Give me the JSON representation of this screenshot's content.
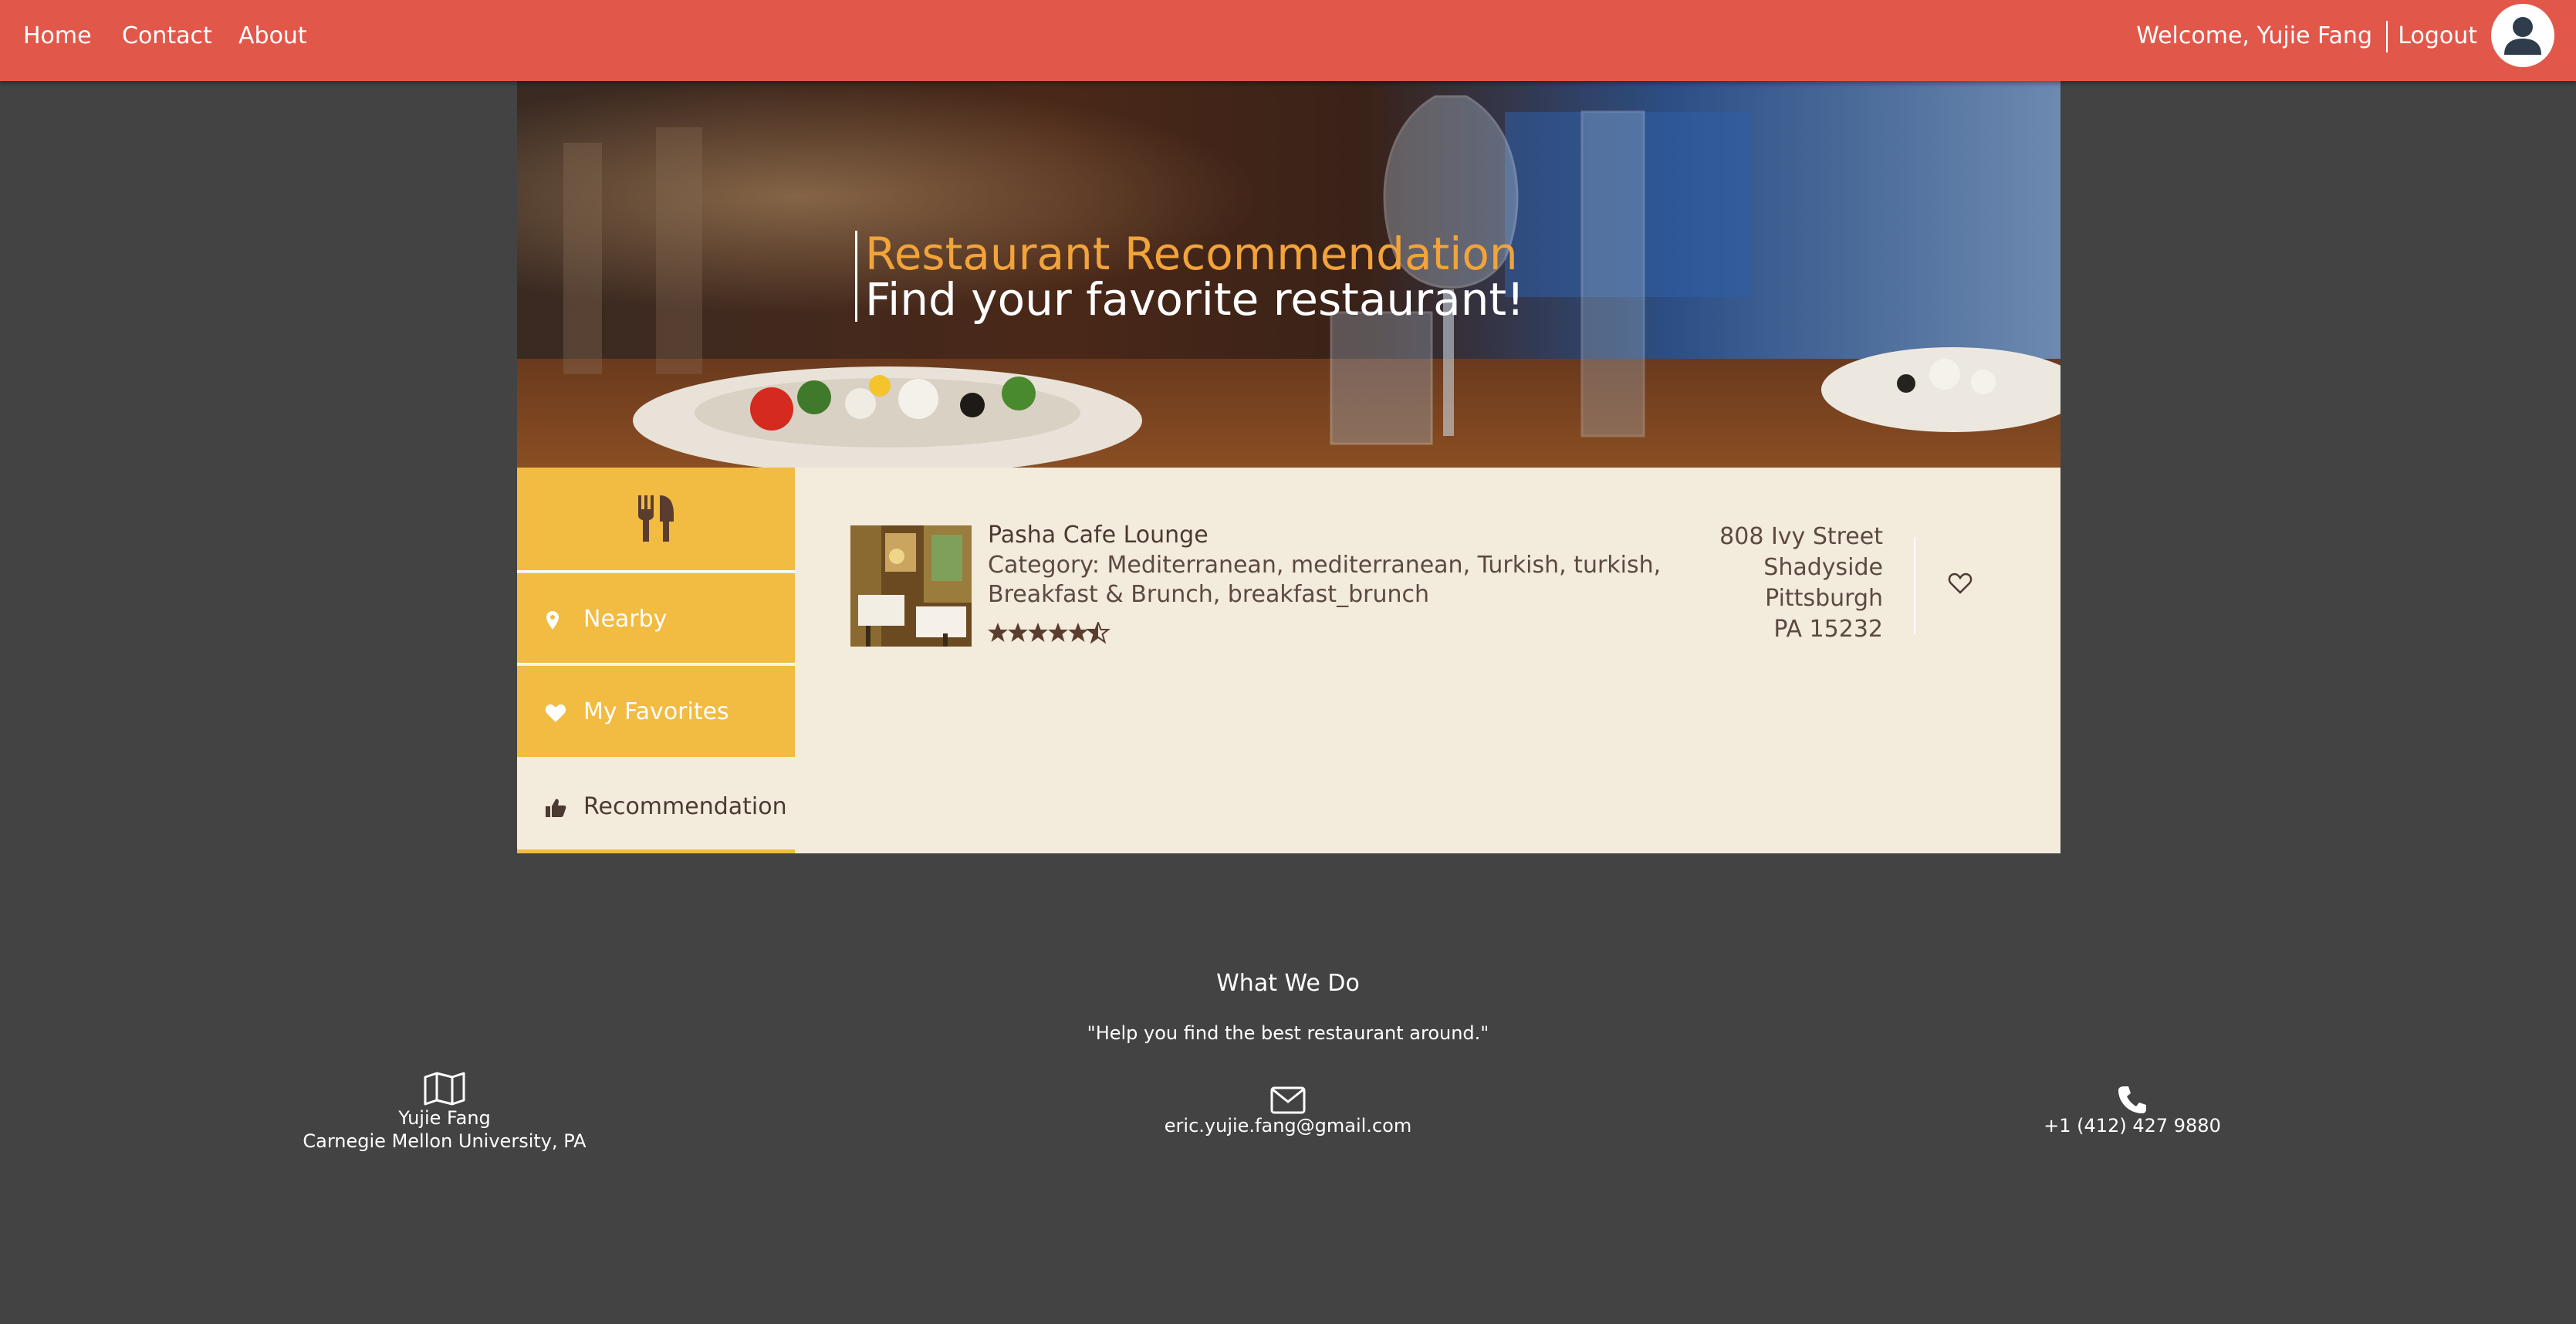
{
  "nav": {
    "home": "Home",
    "contact": "Contact",
    "about": "About",
    "welcome": "Welcome, Yujie Fang",
    "logout": "Logout",
    "avatar_icon": "user-avatar-icon"
  },
  "hero": {
    "title": "Restaurant Recommendation",
    "subtitle": "Find your favorite restaurant!"
  },
  "sidebar": {
    "header_icon": "cutlery-icon",
    "items": [
      {
        "label": "Nearby",
        "icon": "map-marker-icon",
        "active": false
      },
      {
        "label": "My Favorites",
        "icon": "heart-icon",
        "active": false
      },
      {
        "label": "Recommendation",
        "icon": "thumbs-up-icon",
        "active": true
      }
    ]
  },
  "results": [
    {
      "name": "Pasha Cafe Lounge",
      "category": "Category: Mediterranean, mediterranean, Turkish, turkish, Breakfast & Brunch, breakfast_brunch",
      "rating": 4.5,
      "address": [
        "808 Ivy Street",
        "Shadyside",
        "Pittsburgh",
        "PA 15232"
      ],
      "favorite": false
    }
  ],
  "footer": {
    "title": "What We Do",
    "quote": "\"Help you find the best restaurant around.\"",
    "name": "Yujie Fang",
    "location": "Carnegie Mellon University, PA",
    "email": "eric.yujie.fang@gmail.com",
    "phone": "+1 (412) 427 9880"
  },
  "colors": {
    "nav_bg": "#e1584b",
    "page_bg": "#434343",
    "accent_yellow": "#f2bb41",
    "content_bg": "#f3ebdc",
    "hero_title": "#f2a33a"
  }
}
